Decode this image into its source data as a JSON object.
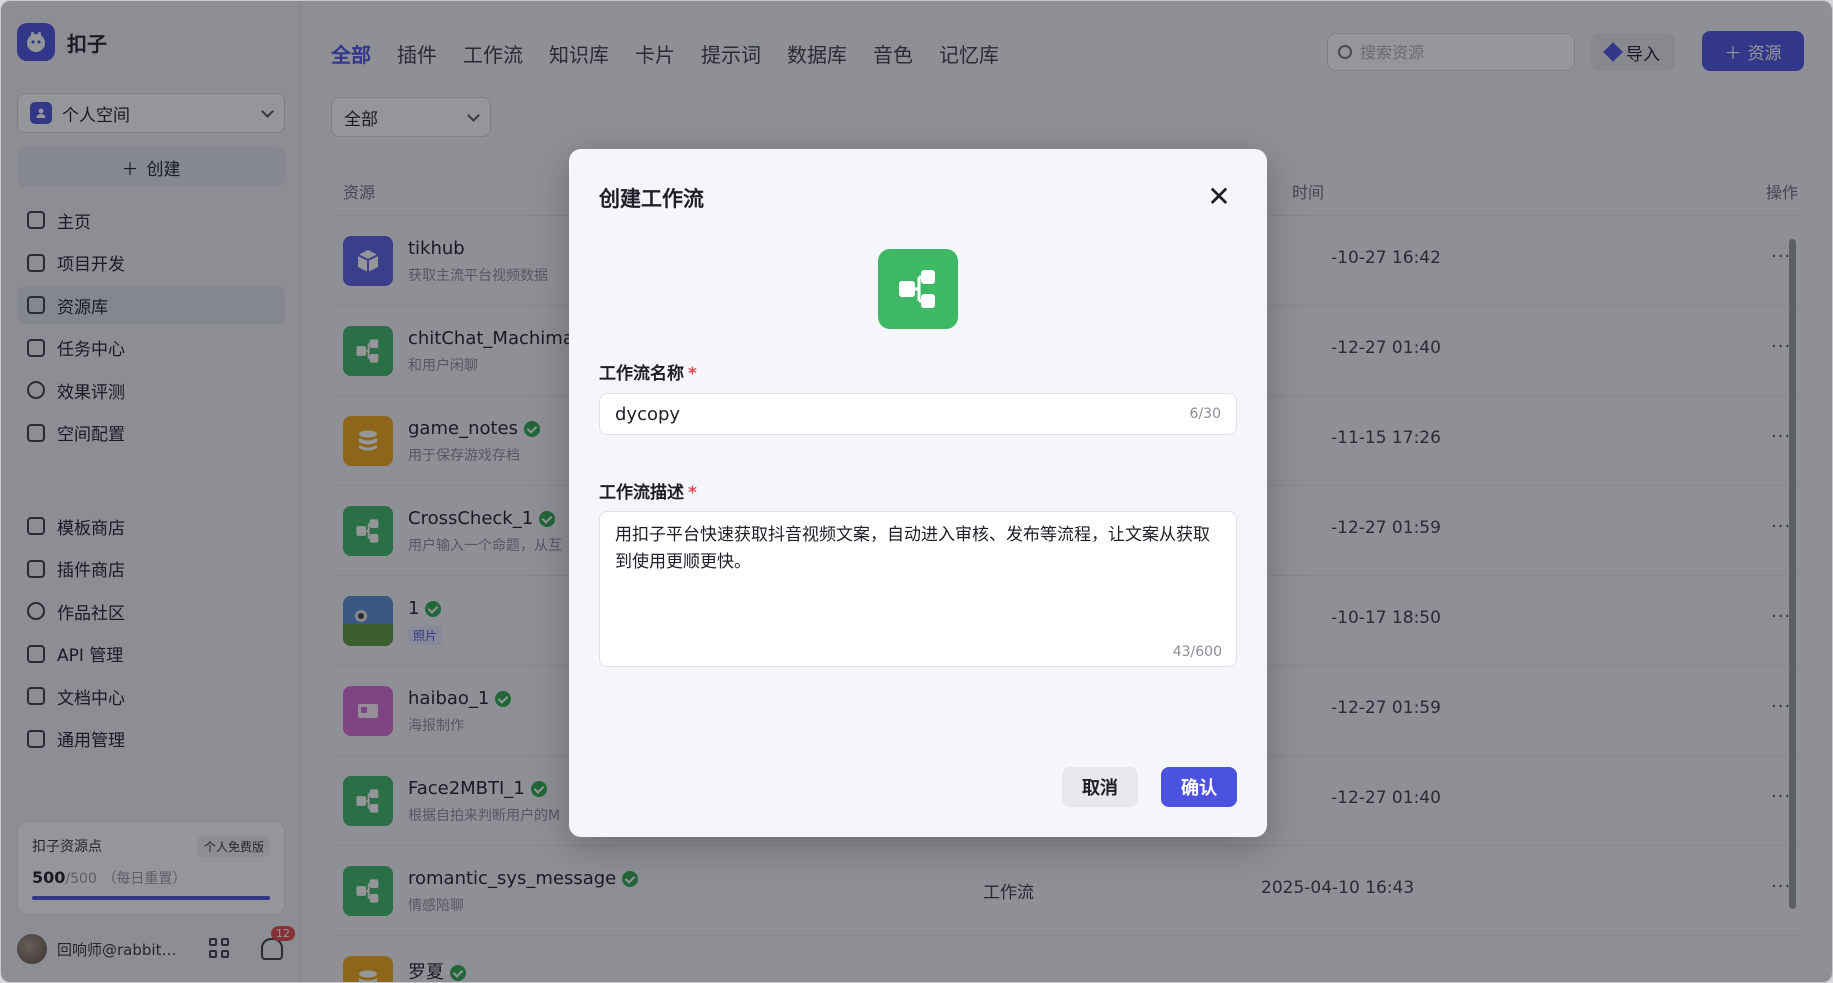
{
  "brand": {
    "name": "扣子"
  },
  "sidebar": {
    "space": {
      "label": "个人空间",
      "icon": "user-icon"
    },
    "create_label": "创建",
    "nav_primary": [
      {
        "label": "主页",
        "icon": "home-icon"
      },
      {
        "label": "项目开发",
        "icon": "project-icon"
      },
      {
        "label": "资源库",
        "icon": "library-icon",
        "active": true
      },
      {
        "label": "任务中心",
        "icon": "task-icon"
      },
      {
        "label": "效果评测",
        "icon": "evaluation-icon"
      },
      {
        "label": "空间配置",
        "icon": "config-icon"
      }
    ],
    "nav_secondary": [
      {
        "label": "模板商店",
        "icon": "template-icon"
      },
      {
        "label": "插件商店",
        "icon": "plugin-icon"
      },
      {
        "label": "作品社区",
        "icon": "community-icon"
      },
      {
        "label": "API 管理",
        "icon": "api-icon"
      },
      {
        "label": "文档中心",
        "icon": "docs-icon"
      },
      {
        "label": "通用管理",
        "icon": "manage-icon"
      }
    ],
    "points": {
      "title": "扣子资源点",
      "badge": "个人免费版",
      "value": "500",
      "total": "/500",
      "note": "（每日重置）",
      "fill_fraction": 1.0
    },
    "user": {
      "name": "回响师@rabbit…",
      "notification_count": "12"
    }
  },
  "main": {
    "tabs": [
      {
        "label": "全部",
        "active": true
      },
      {
        "label": "插件"
      },
      {
        "label": "工作流"
      },
      {
        "label": "知识库"
      },
      {
        "label": "卡片"
      },
      {
        "label": "提示词"
      },
      {
        "label": "数据库"
      },
      {
        "label": "音色"
      },
      {
        "label": "记忆库"
      }
    ],
    "search_placeholder": "搜索资源",
    "import_label": "导入",
    "resource_label": "资源",
    "filter_value": "全部",
    "columns": {
      "resource": "资源",
      "time": "时间",
      "ops": "操作"
    },
    "rows": [
      {
        "name": "tikhub",
        "desc": "获取主流平台视频数据",
        "type": "",
        "time": "-10-27 16:42",
        "icon": "cube-icon",
        "color": "#5b5fe3",
        "verified": false
      },
      {
        "name": "chitChat_Machima",
        "desc": "和用户闲聊",
        "type": "",
        "time": "-12-27 01:40",
        "icon": "workflow-icon",
        "color": "#3fb866",
        "verified": false
      },
      {
        "name": "game_notes",
        "desc": "用于保存游戏存档",
        "type": "",
        "time": "-11-15 17:26",
        "icon": "database-icon",
        "color": "#f0a818",
        "verified": true
      },
      {
        "name": "CrossCheck_1",
        "desc": "用户输入一个命题，从互",
        "type": "",
        "time": "-12-27 01:59",
        "icon": "workflow-icon",
        "color": "#3fb866",
        "verified": true
      },
      {
        "name": "1",
        "desc": "",
        "tag": "照片",
        "type": "",
        "time": "-10-17 18:50",
        "icon": "photo-thumbnail",
        "color": "#6a9a4a",
        "verified": true
      },
      {
        "name": "haibao_1",
        "desc": "海报制作",
        "type": "",
        "time": "-12-27 01:59",
        "icon": "card-icon",
        "color": "#d66ad6",
        "verified": true
      },
      {
        "name": "Face2MBTI_1",
        "desc": "根据自拍来判断用户的M",
        "type": "",
        "time": "-12-27 01:40",
        "icon": "workflow-icon",
        "color": "#3fb866",
        "verified": true
      },
      {
        "name": "romantic_sys_message",
        "desc": "情感陪聊",
        "type": "工作流",
        "time": "2025-04-10 16:43",
        "icon": "workflow-icon",
        "color": "#3fb866",
        "verified": true
      },
      {
        "name": "罗夏",
        "desc": "",
        "type": "",
        "time": "",
        "icon": "database-icon",
        "color": "#f0a818",
        "verified": true
      }
    ],
    "more_label": "···"
  },
  "modal": {
    "title": "创建工作流",
    "icon": "workflow-icon",
    "name_label": "工作流名称",
    "name_value": "dycopy",
    "name_counter": "6/30",
    "desc_label": "工作流描述",
    "desc_value": "用扣子平台快速获取抖音视频文案，自动进入审核、发布等流程，让文案从获取到使用更顺更快。",
    "desc_counter": "43/600",
    "required_mark": "*",
    "cancel_label": "取消",
    "confirm_label": "确认"
  }
}
